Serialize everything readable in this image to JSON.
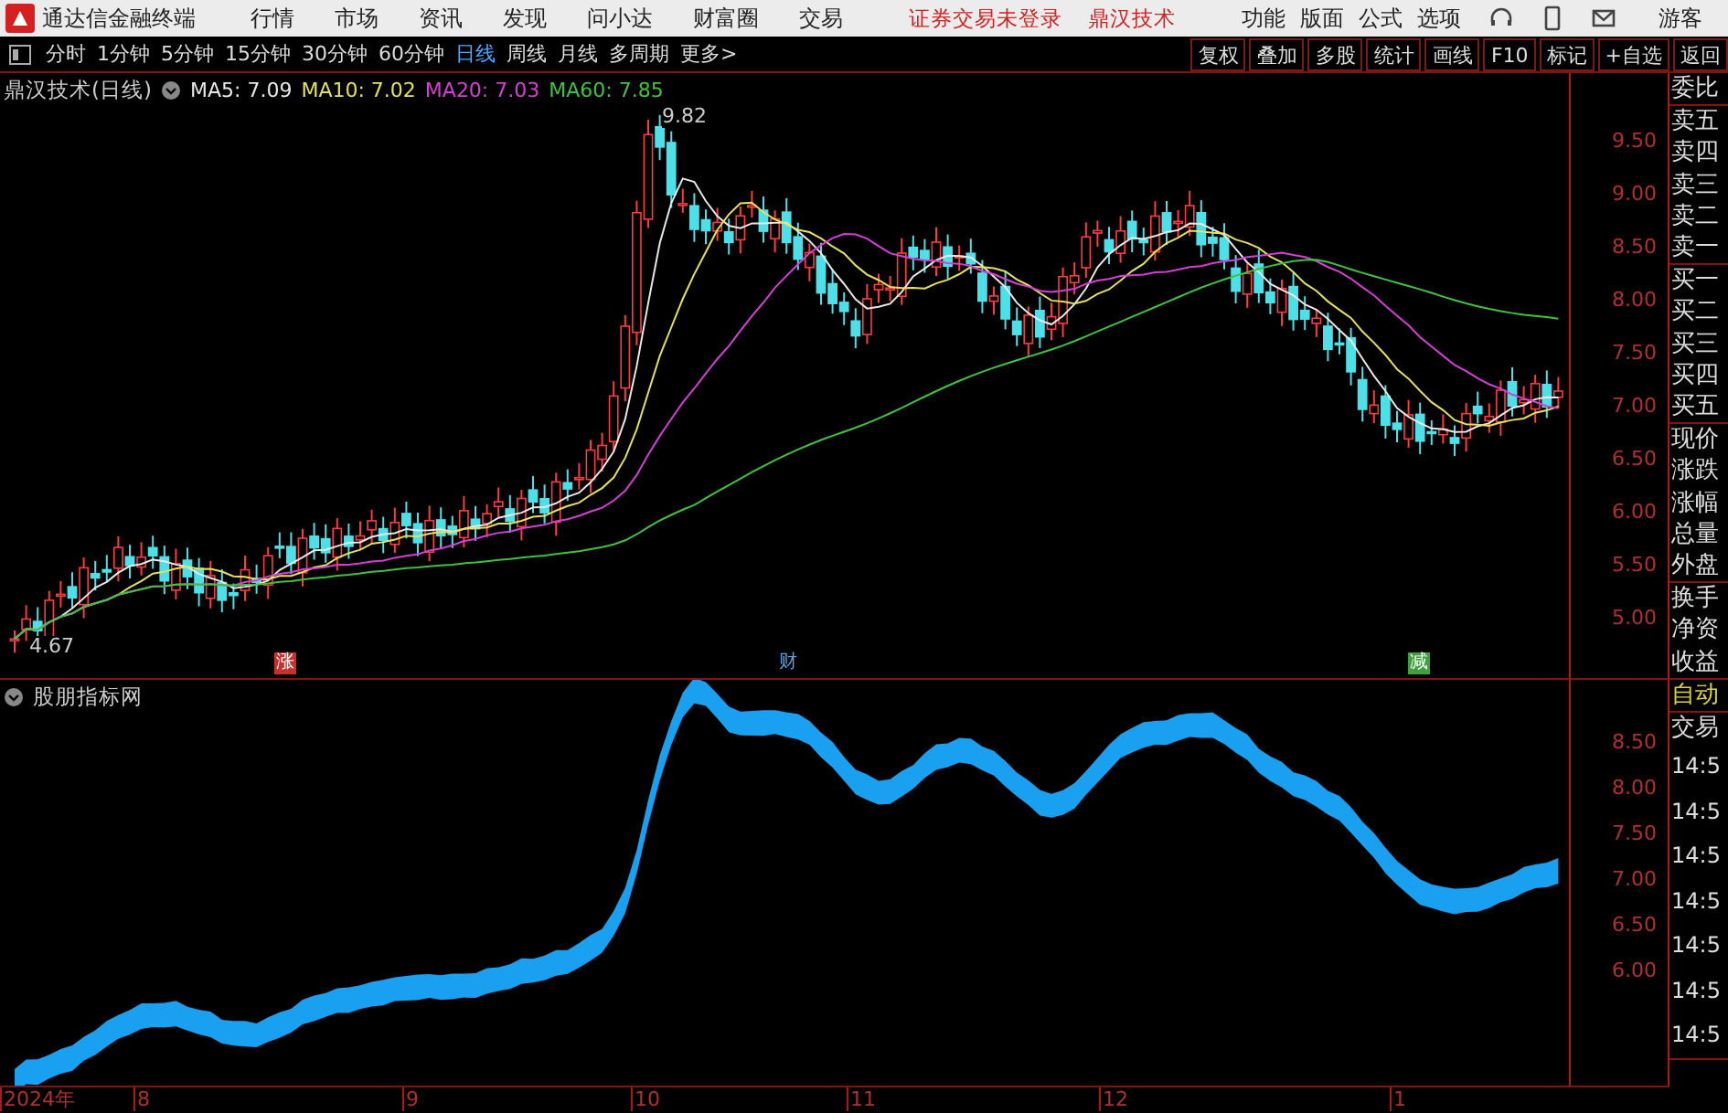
{
  "app_bar": {
    "title": "通达信金融终端",
    "menu": [
      "行情",
      "市场",
      "资讯",
      "发现",
      "问小达",
      "财富圈",
      "交易"
    ],
    "notices": [
      "证券交易未登录",
      "鼎汉技术"
    ],
    "tools": [
      "功能",
      "版面",
      "公式",
      "选项"
    ],
    "user": "游客"
  },
  "toolbar": {
    "periods": [
      {
        "label": "分时",
        "selected": false
      },
      {
        "label": "1分钟",
        "selected": false
      },
      {
        "label": "5分钟",
        "selected": false
      },
      {
        "label": "15分钟",
        "selected": false
      },
      {
        "label": "30分钟",
        "selected": false
      },
      {
        "label": "60分钟",
        "selected": false
      },
      {
        "label": "日线",
        "selected": true
      },
      {
        "label": "周线",
        "selected": false
      },
      {
        "label": "月线",
        "selected": false
      },
      {
        "label": "多周期",
        "selected": false
      },
      {
        "label": "更多>",
        "selected": false
      }
    ],
    "actions": [
      "复权",
      "叠加",
      "多股",
      "统计",
      "画线",
      "F10",
      "标记",
      "+自选",
      "返回"
    ]
  },
  "main_chart": {
    "title": "鼎汉技术(日线)",
    "ma": [
      {
        "label": "MA5: 7.09",
        "color": "#e8e8e8"
      },
      {
        "label": "MA10: 7.02",
        "color": "#e6e05a"
      },
      {
        "label": "MA20: 7.03",
        "color": "#d43fd4"
      },
      {
        "label": "MA60: 7.85",
        "color": "#3fc23f"
      }
    ],
    "high_label": "9.82",
    "low_label": "4.67",
    "events": [
      {
        "label": "涨",
        "color": "#c83030"
      },
      {
        "label": "财",
        "color": "#5aa0e6"
      },
      {
        "label": "减",
        "color": "#3fa03f"
      }
    ],
    "yticks": [
      "9.50",
      "9.00",
      "8.50",
      "8.00",
      "7.50",
      "7.00",
      "6.50",
      "6.00",
      "5.50",
      "5.00"
    ]
  },
  "indicator": {
    "title": "股朋指标网",
    "yticks": [
      "8.50",
      "8.00",
      "7.50",
      "7.00",
      "6.50",
      "6.00"
    ]
  },
  "date_axis": [
    "2024年",
    "8",
    "9",
    "10",
    "11",
    "12",
    "1"
  ],
  "side_panel": {
    "groups": [
      [
        {
          "label": "委比",
          "kind": "label"
        }
      ],
      [
        {
          "label": "卖五",
          "kind": "label"
        },
        {
          "label": "卖四",
          "kind": "label"
        },
        {
          "label": "卖三",
          "kind": "label"
        },
        {
          "label": "卖二",
          "kind": "label"
        },
        {
          "label": "卖一",
          "kind": "label"
        }
      ],
      [
        {
          "label": "买一",
          "kind": "label"
        },
        {
          "label": "买二",
          "kind": "label"
        },
        {
          "label": "买三",
          "kind": "label"
        },
        {
          "label": "买四",
          "kind": "label"
        },
        {
          "label": "买五",
          "kind": "label"
        }
      ],
      [
        {
          "label": "现价",
          "kind": "label"
        },
        {
          "label": "涨跌",
          "kind": "label"
        },
        {
          "label": "涨幅",
          "kind": "label"
        },
        {
          "label": "总量",
          "kind": "label"
        },
        {
          "label": "外盘",
          "kind": "label"
        }
      ],
      [
        {
          "label": "换手",
          "kind": "label"
        },
        {
          "label": "净资",
          "kind": "label"
        },
        {
          "label": "收益",
          "kind": "label"
        }
      ],
      [
        {
          "label": "自动",
          "kind": "status"
        }
      ],
      [
        {
          "label": "交易",
          "kind": "label"
        },
        {
          "label": "14:5",
          "kind": "time"
        },
        {
          "label": "14:5",
          "kind": "time"
        },
        {
          "label": "14:5",
          "kind": "time"
        },
        {
          "label": "14:5",
          "kind": "time"
        },
        {
          "label": "14:5",
          "kind": "time"
        },
        {
          "label": "14:5",
          "kind": "time"
        },
        {
          "label": "14:5",
          "kind": "time"
        }
      ]
    ]
  }
}
